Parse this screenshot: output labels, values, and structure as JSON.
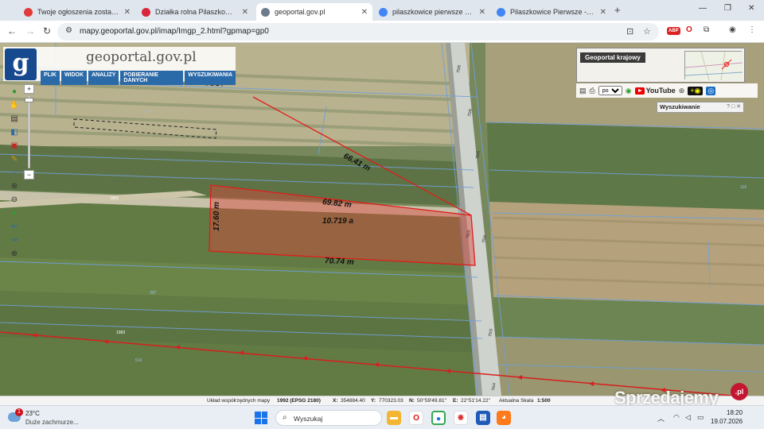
{
  "browser": {
    "tabs": [
      {
        "title": "Twoje ogłoszenia zostały przed",
        "favicon_color": "#e23b3b",
        "active": false
      },
      {
        "title": "Działka rolna Pilaszkowice Pier",
        "favicon_color": "#d9263a",
        "active": false
      },
      {
        "title": "geoportal.gov.pl",
        "favicon_color": "#6d7b8d",
        "active": true
      },
      {
        "title": "pilaszkowice pierwsze działka 8",
        "favicon_color": "#4285f4",
        "active": false
      },
      {
        "title": "Pilaszkowice Pierwsze - Szukaj",
        "favicon_color": "#4285f4",
        "active": false
      }
    ],
    "url": "mapy.geoportal.gov.pl/imap/Imgp_2.html?gpmap=gp0"
  },
  "geoportal": {
    "logo_letter": "g",
    "logo_text": "geoportal.gov.pl",
    "menu": [
      "PLIK",
      "WIDOK",
      "ANALIZY",
      "POBIERANIE DANYCH",
      "WYSZUKIWANIA"
    ],
    "overview_title": "Geoportal krajowy",
    "language": "pol",
    "youtube_label": "YouTube",
    "search_panel": "Wyszukiwanie",
    "search_panel_icons": "? □ ✕",
    "zoom_in": "+",
    "zoom_out": "−"
  },
  "measurements": {
    "diagonal": "66.41 m",
    "top": "69.82 m",
    "area": "10.719 a",
    "left": "17.60 m",
    "bottom": "70.74 m"
  },
  "map_labels": {
    "road_1": "1901",
    "field_1": "1983",
    "field_2": "307",
    "field_3": "514",
    "field_4": "1902",
    "parcel_1": "75/8",
    "parcel_2": "75/6",
    "parcel_3": "75/5",
    "parcel_4": "75/4",
    "parcel_5": "75/3",
    "parcel_6": "76/3",
    "parcel_7": "76/4",
    "side_1": "1.4",
    "side_2": "102"
  },
  "statusbar": {
    "coord_system": "Układ współrzędnych mapy",
    "coord_value": "1992 (EPSG 2180)",
    "x_label": "X:",
    "x_value": "354884.40",
    "y_label": "Y:",
    "y_value": "770323.03",
    "n_label": "N:",
    "n_value": "50°59'49.81\"",
    "e_label": "E:",
    "e_value": "22°51'14.22\"",
    "scale_label": "Aktualna Skala",
    "scale_value": "1:500"
  },
  "watermark": {
    "brand": "Sprzedajemy",
    "dot": ".pl"
  },
  "taskbar": {
    "weather_badge": "1",
    "temperature": "23°C",
    "condition": "Duże zachmurze...",
    "search_placeholder": "Wyszukaj",
    "time": "18:20",
    "date": "19.07.2026"
  }
}
